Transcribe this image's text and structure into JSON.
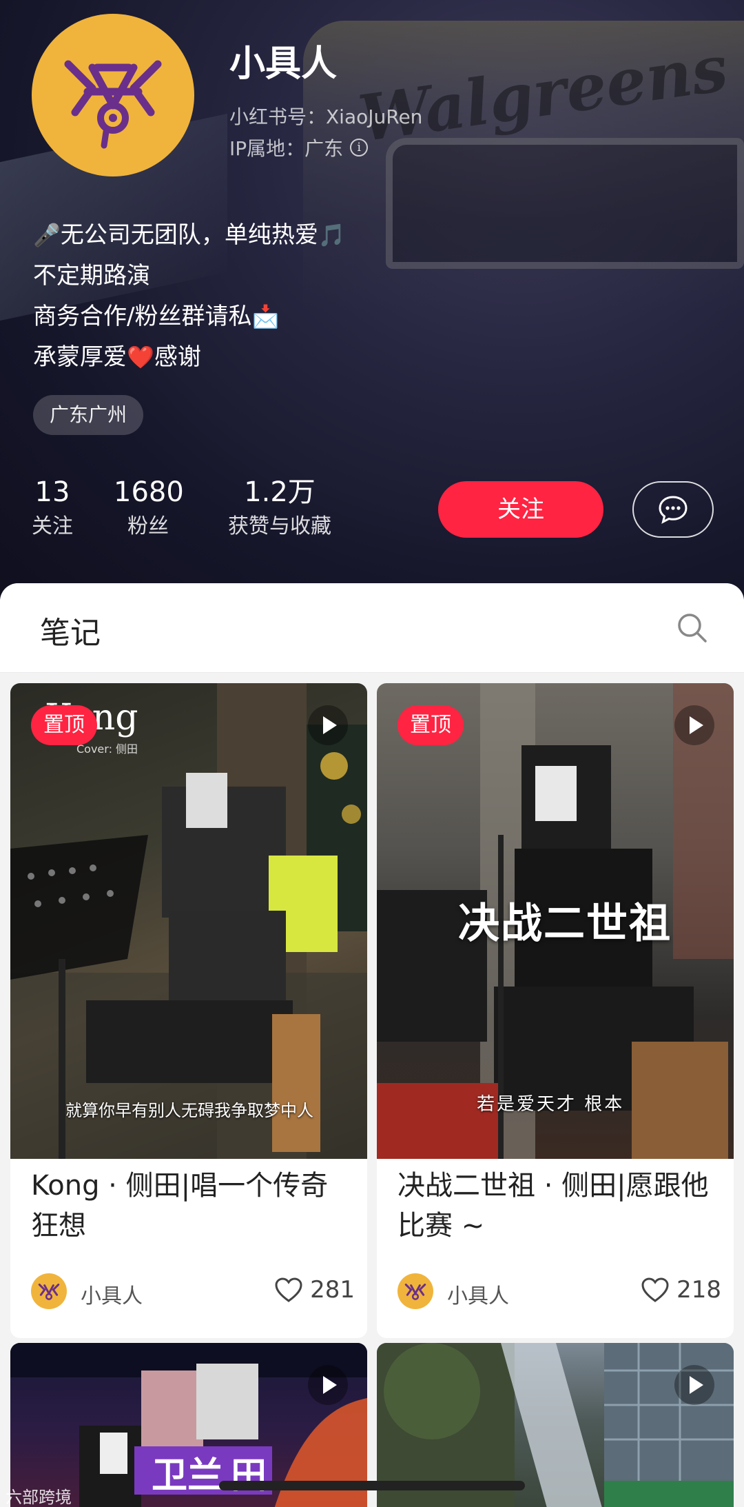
{
  "profile": {
    "nickname": "小具人",
    "red_id_label": "小红书号：XiaoJuRen",
    "ip_label": "IP属地：广东",
    "bio": [
      {
        "text": "无公司无团队，单纯热爱",
        "pre_emoji": "🎤",
        "post_emoji": "🎵"
      },
      {
        "text": "不定期路演",
        "pre_emoji": "",
        "post_emoji": ""
      },
      {
        "text": "商务合作/粉丝群请私",
        "pre_emoji": "",
        "post_emoji": "📩"
      },
      {
        "text_a": "承蒙厚爱",
        "mid_emoji": "❤️",
        "text_b": "感谢"
      }
    ],
    "location_tag": "广东广州",
    "stats": {
      "following": {
        "value": "13",
        "label": "关注"
      },
      "followers": {
        "value": "1680",
        "label": "粉丝"
      },
      "likes": {
        "value": "1.2万",
        "label": "获赞与收藏"
      }
    },
    "follow_label": "关注",
    "accent_color": "#ff2442",
    "avatar_color": "#f0b43c",
    "background_text": "Walgreens"
  },
  "notes": {
    "section_title": "笔记",
    "cards": [
      {
        "pinned": true,
        "pin_label": "置顶",
        "cover_title": "Kong",
        "cover_subtitle": "Cover: 侧田",
        "cover_caption": "就算你早有别人无碍我争取梦中人",
        "title": "Kong · 侧田|唱一个传奇狂想",
        "author": "小具人",
        "likes": "281"
      },
      {
        "pinned": true,
        "pin_label": "置顶",
        "cover_title": "决战二世祖",
        "cover_caption": "若是爱天才  根本",
        "title": "决战二世祖 · 侧田|愿跟他比赛 ~",
        "author": "小具人",
        "likes": "218"
      },
      {
        "pinned": false,
        "cover_title": "卫兰",
        "cover_title_b": "田"
      },
      {
        "pinned": false
      }
    ]
  },
  "watermark": "六部跨境"
}
